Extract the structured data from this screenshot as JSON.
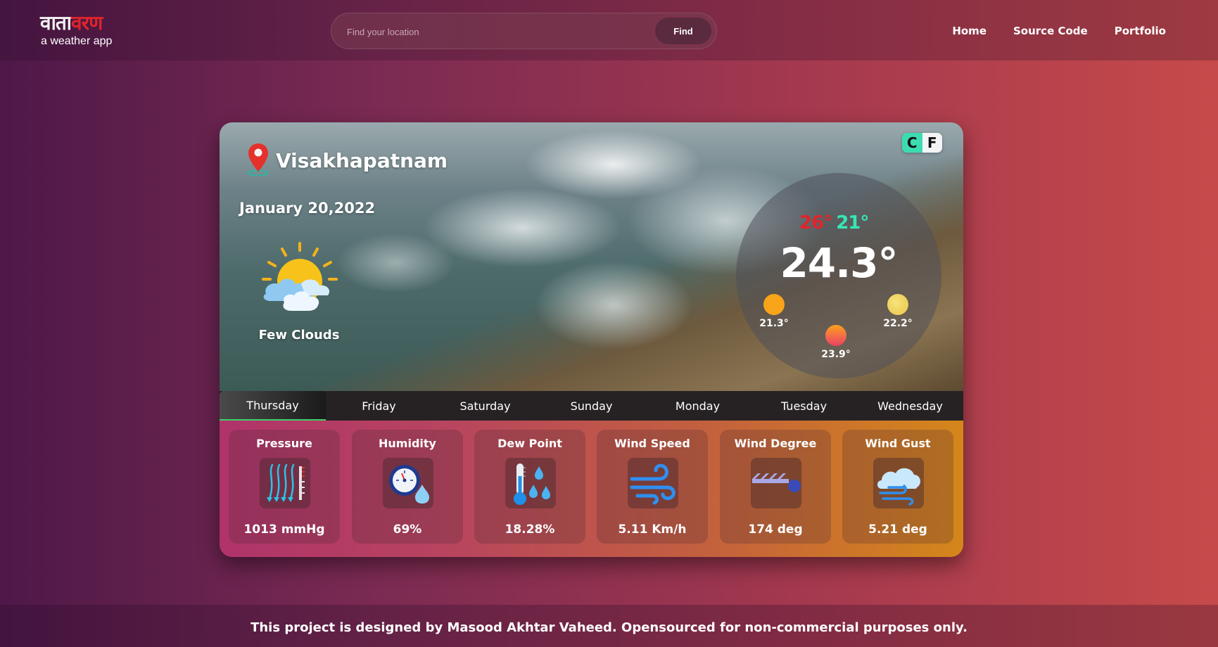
{
  "header": {
    "logo_part1": "वाता",
    "logo_part2": "वरण",
    "logo_subtitle": "a weather app",
    "search_placeholder": "Find your location",
    "search_value": "",
    "find_label": "Find",
    "nav": [
      "Home",
      "Source Code",
      "Portfolio"
    ]
  },
  "weather": {
    "location": "Visakhapatnam",
    "date": "January 20,2022",
    "description": "Few Clouds",
    "icon": "sun-behind-clouds-icon",
    "unit_c": "C",
    "unit_f": "F",
    "active_unit": "C",
    "temp_high": "26°",
    "temp_low": "21°",
    "temp_current": "24.3°",
    "morning_temp": "21.3°",
    "evening_temp": "23.9°",
    "night_temp": "22.2°"
  },
  "tabs": [
    "Thursday",
    "Friday",
    "Saturday",
    "Sunday",
    "Monday",
    "Tuesday",
    "Wednesday"
  ],
  "active_tab": "Thursday",
  "stats": [
    {
      "label": "Pressure",
      "value": "1013 mmHg",
      "icon": "pressure-icon"
    },
    {
      "label": "Humidity",
      "value": "69%",
      "icon": "humidity-gauge-icon"
    },
    {
      "label": "Dew Point",
      "value": "18.28%",
      "icon": "thermometer-drops-icon"
    },
    {
      "label": "Wind Speed",
      "value": "5.11 Km/h",
      "icon": "wind-icon"
    },
    {
      "label": "Wind Degree",
      "value": "174 deg",
      "icon": "wind-direction-icon"
    },
    {
      "label": "Wind Gust",
      "value": "5.21 deg",
      "icon": "cloud-wind-icon"
    }
  ],
  "footer": {
    "text": "This project is designed by Masood Akhtar Vaheed. Opensourced for non-commercial purposes only."
  },
  "colors": {
    "accent_red": "#e0242b",
    "accent_green": "#36e6b4",
    "tab_active_underline": "#3fcf6a"
  }
}
